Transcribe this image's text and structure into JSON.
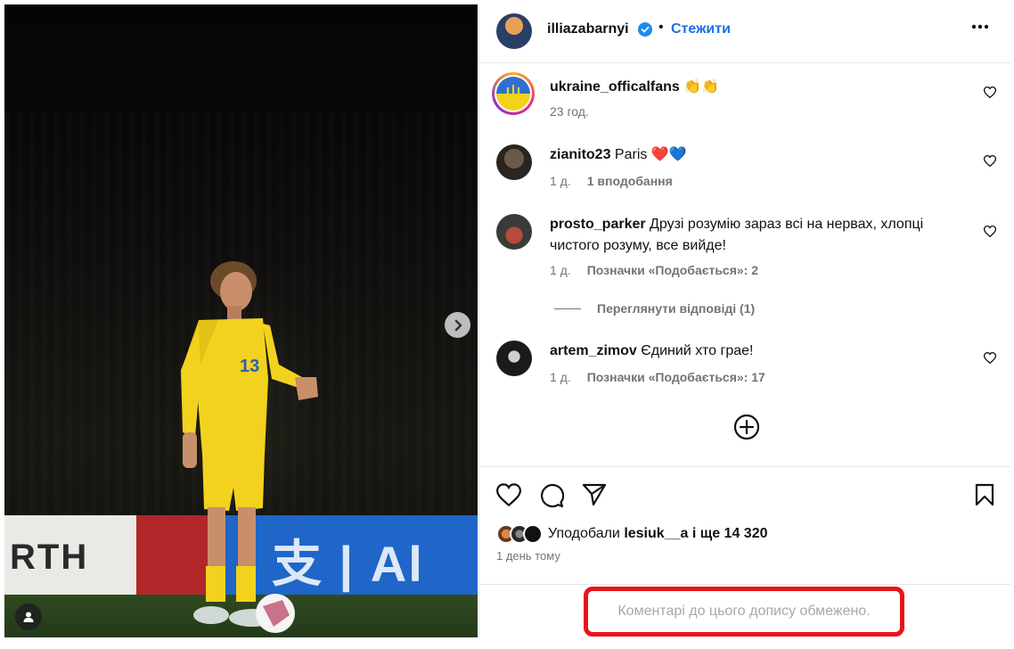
{
  "post": {
    "author": "illiazabarnyi",
    "follow_label": "Стежити",
    "separator": "•",
    "photo_board_left": "RTH",
    "photo_board_right": "支 | Al",
    "jersey_number": "13"
  },
  "comments": [
    {
      "username": "ukraine_officalfans",
      "text": " 👏👏",
      "time": "23 год.",
      "likes": ""
    },
    {
      "username": "zianito23",
      "text": " Paris ❤️💙",
      "time": "1 д.",
      "likes": "1 вподобання"
    },
    {
      "username": "prosto_parker",
      "text": " Друзі розумію зараз всі на нервах, хлопці чистого розуму, все вийде!",
      "time": "1 д.",
      "likes": "Позначки «Подобається»: 2"
    },
    {
      "username": "artem_zimov",
      "text": " Єдиний хто грае!",
      "time": "1 д.",
      "likes": "Позначки «Подобається»: 17"
    }
  ],
  "replies_label": "Переглянути відповіді (1)",
  "likes_summary": {
    "prefix": "Уподобали ",
    "user": "lesiuk__a",
    "suffix": " і ще 14 320"
  },
  "post_date": "1 день тому",
  "comments_restricted": "Коментарі до цього допису обмежено.",
  "colors": {
    "follow": "#1a6fe8",
    "highlight_border": "#e8141c",
    "muted_text": "#737373"
  },
  "icons": [
    "verified-badge-icon",
    "more-options-icon",
    "heart-icon",
    "comment-icon",
    "share-icon",
    "bookmark-icon",
    "add-circle-icon",
    "chevron-right-icon",
    "user-tag-icon"
  ]
}
